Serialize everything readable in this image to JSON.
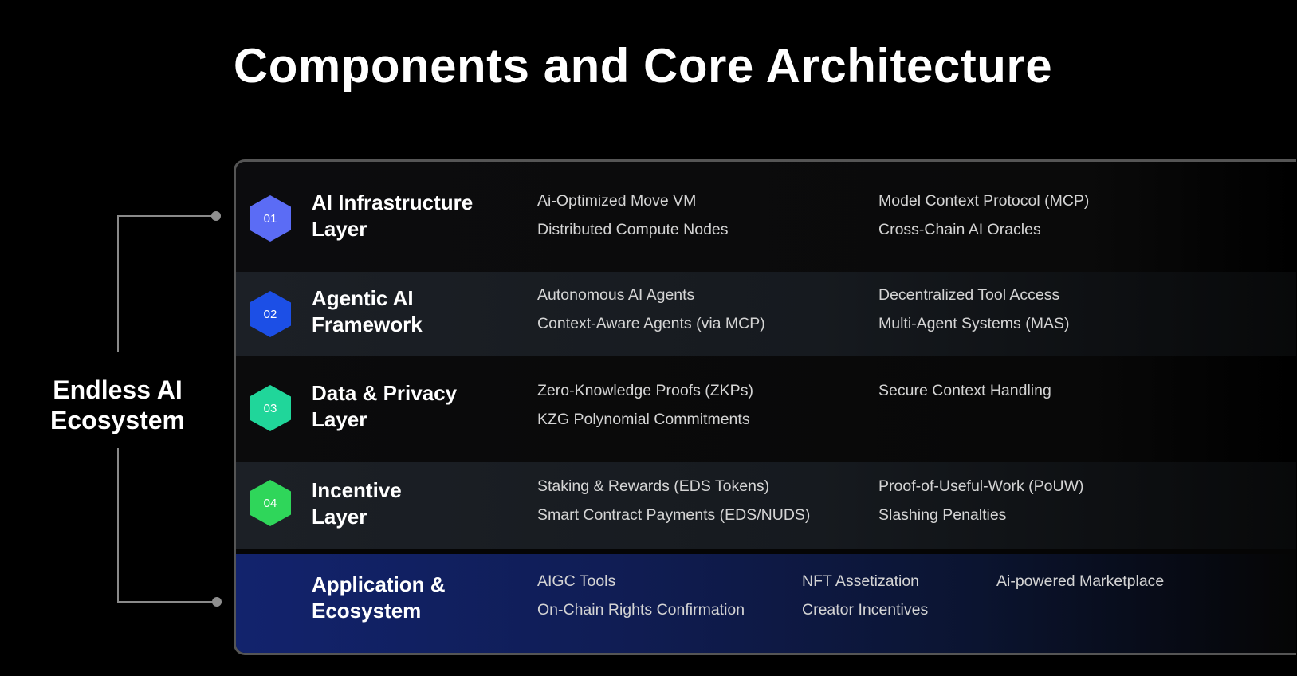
{
  "title": "Components and Core Architecture",
  "ecosystem_label": "Endless AI Ecosystem",
  "colors": {
    "background": "#000000",
    "hex_01": "#5b6cf5",
    "hex_02": "#1c4fe6",
    "hex_03": "#20d69a",
    "hex_04": "#2fd65a",
    "application_row": "#12236d"
  },
  "layers": [
    {
      "number": "01",
      "name_line1": "AI Infrastructure",
      "name_line2": "Layer",
      "items": [
        "Ai-Optimized Move VM",
        "Distributed Compute Nodes",
        "Model Context Protocol (MCP)",
        "Cross-Chain AI Oracles"
      ]
    },
    {
      "number": "02",
      "name_line1": "Agentic AI",
      "name_line2": "Framework",
      "items": [
        "Autonomous AI Agents",
        "Context-Aware Agents (via MCP)",
        "Decentralized Tool Access",
        "Multi-Agent Systems (MAS)"
      ]
    },
    {
      "number": "03",
      "name_line1": "Data & Privacy",
      "name_line2": "Layer",
      "items": [
        "Zero-Knowledge Proofs (ZKPs)",
        "KZG Polynomial Commitments",
        "Secure Context Handling"
      ]
    },
    {
      "number": "04",
      "name_line1": "Incentive",
      "name_line2": "Layer",
      "items": [
        "Staking & Rewards (EDS Tokens)",
        "Smart Contract Payments (EDS/NUDS)",
        "Proof-of-Useful-Work (PoUW)",
        "Slashing Penalties"
      ]
    },
    {
      "name_line1": "Application &",
      "name_line2": "Ecosystem",
      "items": [
        "AIGC Tools",
        "On-Chain Rights Confirmation",
        "NFT Assetization",
        "Creator Incentives",
        "Ai-powered Marketplace"
      ]
    }
  ]
}
